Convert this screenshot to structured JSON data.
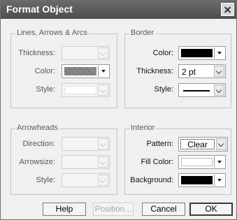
{
  "window": {
    "title": "Format Object"
  },
  "lines_group": {
    "title": "Lines, Arrows & Arcs",
    "thickness_label": "Thickness:",
    "color_label": "Color:",
    "style_label": "Style:"
  },
  "border_group": {
    "title": "Border",
    "color_label": "Color:",
    "color_value": "#000000",
    "thickness_label": "Thickness:",
    "thickness_value": "2 pt",
    "style_label": "Style:"
  },
  "arrowheads_group": {
    "title": "Arrowheads",
    "direction_label": "Direction:",
    "arrowsize_label": "Arrowsize:",
    "style_label": "Style:"
  },
  "interior_group": {
    "title": "Interior",
    "pattern_label": "Pattern:",
    "pattern_value": "Clear",
    "fill_color_label": "Fill Color:",
    "fill_color_value": "#ffffff",
    "background_label": "Background:",
    "background_value": "#000000"
  },
  "buttons": {
    "help": "Help",
    "position": "Position...",
    "cancel": "Cancel",
    "ok": "OK"
  }
}
